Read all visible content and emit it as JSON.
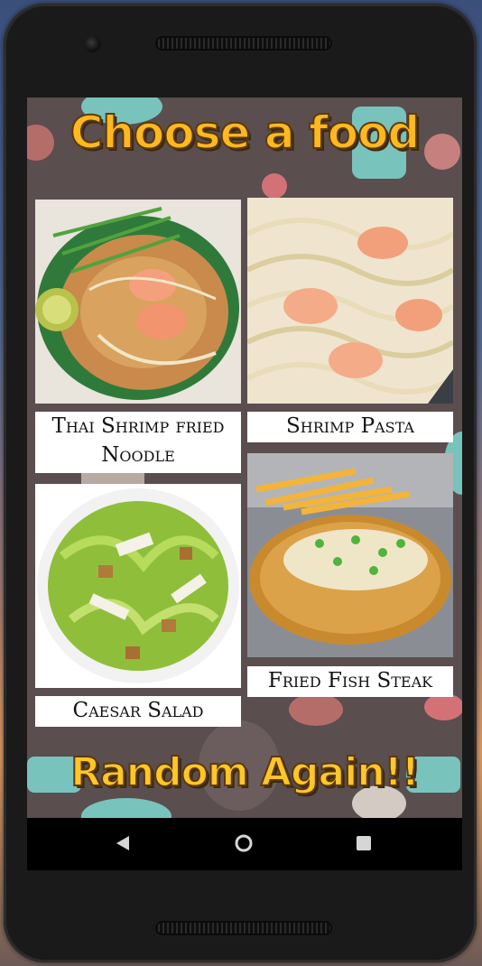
{
  "app": {
    "title": "Choose a food",
    "random_button": "Random Again!!"
  },
  "foods": [
    {
      "name": "Thai Shrimp fried",
      "name_line2": "Noodle"
    },
    {
      "name": "Shrimp Pasta"
    },
    {
      "name": "Caesar Salad"
    },
    {
      "name": "Fried Fish Steak"
    }
  ],
  "nav": {
    "back_icon": "back-triangle-icon",
    "home_icon": "home-circle-icon",
    "recents_icon": "recents-square-icon"
  },
  "colors": {
    "title": "#ffb81f",
    "background": "#5a4e4f",
    "accent_teal": "#7fd8d0",
    "label_bg": "#ffffff"
  }
}
